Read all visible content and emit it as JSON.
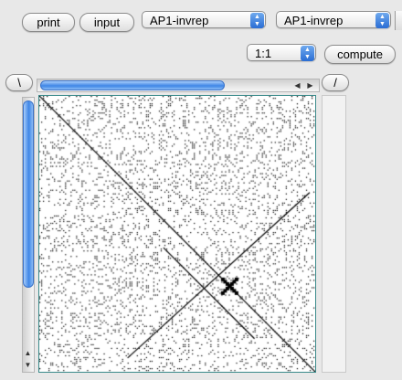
{
  "toolbar": {
    "print_label": "print",
    "input_label": "input",
    "sequence_a": "AP1-invrep",
    "sequence_b": "AP1-invrep",
    "ratio": "1:1",
    "compute_label": "compute"
  },
  "nav": {
    "left_label": "\\",
    "right_label": "/"
  },
  "icons": {
    "popup_arrows": "up-down-arrows-icon",
    "scroll_left": "arrow-left-icon",
    "scroll_right": "arrow-right-icon",
    "scroll_up": "arrow-up-icon",
    "scroll_down": "arrow-down-icon"
  },
  "colors": {
    "accent": "#3f86e6",
    "frame": "#3a8a8a",
    "dots": "#000000"
  }
}
